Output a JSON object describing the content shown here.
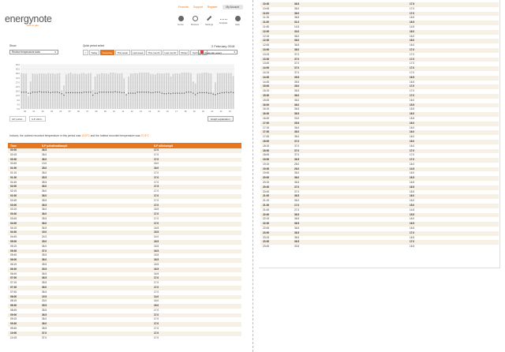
{
  "header": {
    "brand_name": "energynote",
    "tagline": "both to gas",
    "top_links": [
      "Promote",
      "Support",
      "Register"
    ],
    "account_label": "My Account",
    "nav": [
      {
        "label": "Home",
        "icon": "home-icon"
      },
      {
        "label": "Devices",
        "icon": "power-icon"
      },
      {
        "label": "Settings",
        "icon": "wrench-icon"
      },
      {
        "label": "Analysis",
        "icon": "wave-icon"
      },
      {
        "label": "Help",
        "icon": "info-icon"
      }
    ]
  },
  "controls": {
    "show_label": "Show",
    "show_value": "Review temperature data",
    "quick_period_label": "Quick period select",
    "date_label": "2 February 2018",
    "quick_buttons": [
      "<",
      "Today",
      "Yesterday",
      "This week",
      "Last week",
      "This month",
      "Last month",
      "Winter",
      "Spring",
      ">"
    ],
    "active_button": "Yesterday",
    "calendar_label": "Calendar select"
  },
  "chart_data": {
    "type": "bar",
    "series": [
      {
        "name": "ILP pohatheatlampit",
        "color": "#cfcfcf"
      },
      {
        "name": "ILP ollinkampit",
        "color": "#555555"
      }
    ],
    "categories": [
      "00",
      "01",
      "02",
      "03",
      "04",
      "05",
      "06",
      "07",
      "08",
      "09",
      "10",
      "11",
      "12",
      "13",
      "14",
      "15",
      "16",
      "17",
      "18",
      "19",
      "20",
      "21",
      "22",
      "23"
    ],
    "ylim": [
      0,
      45
    ],
    "ytick_labels": [
      "45.0",
      "40.5",
      "36.0",
      "31.5",
      "27.0",
      "22.5",
      "18.0",
      "13.5",
      "9.0",
      "4.5",
      "0.0"
    ]
  },
  "legend": [
    "ILP pohat...",
    "ILP ollinh..."
  ],
  "graph_button_label": "Graph explanation",
  "summary": {
    "prefix": "Indoors, the coldest recorded temperature in this period was",
    "cold_value": "13.0°C",
    "middle": "and the hottest recorded temperature was",
    "hot_value": "37.5°C"
  },
  "table": {
    "columns": [
      "Time",
      "ILP pohatheatlampit",
      "ILP ollinkampit"
    ],
    "rows_left": [
      [
        "00:00",
        "36.5",
        "17.0"
      ],
      [
        "00:15",
        "36.0",
        "17.0"
      ],
      [
        "00:30",
        "36.0",
        "17.0"
      ],
      [
        "00:45",
        "13.0",
        "16.0"
      ],
      [
        "01:00",
        "28.0",
        "16.0"
      ],
      [
        "01:15",
        "36.0",
        "17.0"
      ],
      [
        "01:30",
        "35.5",
        "17.0"
      ],
      [
        "01:45",
        "35.5",
        "17.0"
      ],
      [
        "02:00",
        "36.0",
        "17.5"
      ],
      [
        "02:15",
        "36.0",
        "17.0"
      ],
      [
        "02:30",
        "36.0",
        "17.0"
      ],
      [
        "02:45",
        "35.5",
        "17.0"
      ],
      [
        "03:00",
        "36.5",
        "17.0"
      ],
      [
        "03:15",
        "36.0",
        "16.5"
      ],
      [
        "03:30",
        "36.0",
        "17.0"
      ],
      [
        "03:45",
        "35.5",
        "17.0"
      ],
      [
        "04:00",
        "36.0",
        "17.0"
      ],
      [
        "04:15",
        "36.5",
        "16.5"
      ],
      [
        "04:30",
        "19.0",
        "15.5"
      ],
      [
        "04:45",
        "24.0",
        "14.0"
      ],
      [
        "05:00",
        "35.0",
        "16.5"
      ],
      [
        "05:15",
        "36.0",
        "16.5"
      ],
      [
        "05:30",
        "37.0",
        "16.5"
      ],
      [
        "05:45",
        "35.5",
        "16.5"
      ],
      [
        "06:00",
        "36.0",
        "16.5"
      ],
      [
        "06:15",
        "35.5",
        "16.5"
      ],
      [
        "06:30",
        "35.5",
        "16.5"
      ],
      [
        "06:45",
        "36.5",
        "16.5"
      ],
      [
        "07:00",
        "36.5",
        "17.0"
      ],
      [
        "07:15",
        "35.5",
        "17.0"
      ],
      [
        "07:30",
        "36.0",
        "17.0"
      ],
      [
        "07:45",
        "36.5",
        "17.0"
      ],
      [
        "08:00",
        "19.5",
        "14.0"
      ],
      [
        "08:15",
        "33.0",
        "16.0"
      ],
      [
        "08:30",
        "35.5",
        "16.0"
      ],
      [
        "08:45",
        "35.5",
        "17.0"
      ],
      [
        "09:00",
        "36.5",
        "17.0"
      ],
      [
        "09:15",
        "36.0",
        "17.0"
      ],
      [
        "09:30",
        "36.0",
        "17.0"
      ],
      [
        "09:45",
        "35.5",
        "17.0"
      ],
      [
        "10:00",
        "37.0",
        "17.0"
      ],
      [
        "10:15",
        "37.0",
        "17.0"
      ]
    ],
    "rows_right": [
      [
        "10:30",
        "36.5",
        "17.5"
      ],
      [
        "10:45",
        "36.0",
        "17.0"
      ],
      [
        "11:00",
        "36.0",
        "17.0"
      ],
      [
        "11:15",
        "36.5",
        "16.5"
      ],
      [
        "11:30",
        "31.0",
        "16.5"
      ],
      [
        "11:45",
        "14.5",
        "14.5"
      ],
      [
        "12:00",
        "33.0",
        "16.0"
      ],
      [
        "12:15",
        "36.0",
        "16.0"
      ],
      [
        "12:30",
        "36.0",
        "16.0"
      ],
      [
        "12:45",
        "36.5",
        "16.0"
      ],
      [
        "13:00",
        "36.0",
        "17.0"
      ],
      [
        "13:15",
        "37.0",
        "17.0"
      ],
      [
        "13:30",
        "37.0",
        "17.0"
      ],
      [
        "13:45",
        "37.0",
        "17.0"
      ],
      [
        "14:00",
        "37.0",
        "17.0"
      ],
      [
        "14:15",
        "37.0",
        "17.0"
      ],
      [
        "14:30",
        "35.5",
        "16.5"
      ],
      [
        "14:45",
        "35.5",
        "16.5"
      ],
      [
        "15:00",
        "35.0",
        "17.0"
      ],
      [
        "15:15",
        "36.5",
        "17.0"
      ],
      [
        "15:30",
        "36.0",
        "17.0"
      ],
      [
        "15:45",
        "36.0",
        "16.0"
      ],
      [
        "16:00",
        "36.0",
        "15.5"
      ],
      [
        "16:15",
        "36.5",
        "15.5"
      ],
      [
        "16:30",
        "36.5",
        "16.0"
      ],
      [
        "16:45",
        "33.0",
        "15.5"
      ],
      [
        "17:00",
        "35.5",
        "16.0"
      ],
      [
        "17:15",
        "36.0",
        "16.0"
      ],
      [
        "17:30",
        "36.0",
        "16.0"
      ],
      [
        "17:45",
        "36.0",
        "16.0"
      ],
      [
        "18:00",
        "37.0",
        "16.0"
      ],
      [
        "18:15",
        "37.0",
        "16.0"
      ],
      [
        "18:30",
        "37.0",
        "17.0"
      ],
      [
        "18:45",
        "37.0",
        "17.0"
      ],
      [
        "19:00",
        "36.5",
        "17.0"
      ],
      [
        "19:15",
        "28.0",
        "16.0"
      ],
      [
        "19:30",
        "26.0",
        "14.5"
      ],
      [
        "19:45",
        "36.0",
        "16.0"
      ],
      [
        "20:00",
        "36.0",
        "16.5"
      ],
      [
        "20:15",
        "36.5",
        "16.5"
      ],
      [
        "20:30",
        "37.0",
        "16.5"
      ],
      [
        "20:45",
        "37.0",
        "16.5"
      ],
      [
        "21:00",
        "36.5",
        "16.0"
      ],
      [
        "21:15",
        "36.0",
        "16.0"
      ],
      [
        "21:30",
        "17.0",
        "15.0"
      ],
      [
        "21:45",
        "27.0",
        "14.5"
      ],
      [
        "22:00",
        "36.5",
        "15.5"
      ],
      [
        "22:15",
        "36.5",
        "16.0"
      ],
      [
        "22:30",
        "36.5",
        "16.5"
      ],
      [
        "22:45",
        "36.5",
        "16.5"
      ],
      [
        "23:00",
        "36.5",
        "17.0"
      ],
      [
        "23:15",
        "36.5",
        "16.5"
      ],
      [
        "23:30",
        "36.5",
        "17.0"
      ],
      [
        "23:45",
        "33.5",
        "16.5"
      ]
    ]
  }
}
